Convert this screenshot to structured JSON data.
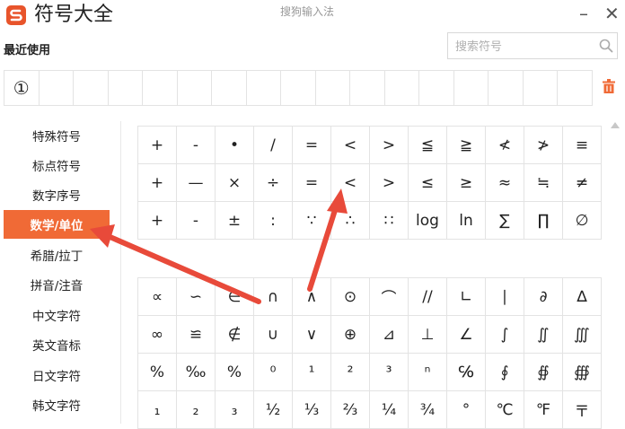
{
  "window": {
    "title": "符号大全",
    "subtitle": "搜狗输入法",
    "minimize_glyph": "–",
    "close_glyph": "✕"
  },
  "recent": {
    "label": "最近使用",
    "items": [
      "①",
      "",
      "",
      "",
      "",
      "",
      "",
      "",
      "",
      "",
      "",
      "",
      "",
      "",
      "",
      "",
      ""
    ]
  },
  "search": {
    "placeholder": "搜索符号",
    "value": ""
  },
  "sidebar": {
    "items": [
      {
        "label": "特殊符号",
        "active": false
      },
      {
        "label": "标点符号",
        "active": false
      },
      {
        "label": "数字序号",
        "active": false
      },
      {
        "label": "数学/单位",
        "active": true
      },
      {
        "label": "希腊/拉丁",
        "active": false
      },
      {
        "label": "拼音/注音",
        "active": false
      },
      {
        "label": "中文字符",
        "active": false
      },
      {
        "label": "英文音标",
        "active": false
      },
      {
        "label": "日文字符",
        "active": false
      },
      {
        "label": "韩文字符",
        "active": false
      }
    ]
  },
  "symbols_top": [
    [
      "+",
      "-",
      "•",
      "/",
      "=",
      "<",
      ">",
      "≦",
      "≧",
      "≮",
      "≯",
      "≡"
    ],
    [
      "+",
      "—",
      "×",
      "÷",
      "=",
      "<",
      ">",
      "≤",
      "≥",
      "≈",
      "≒",
      "≠"
    ],
    [
      "+",
      "-",
      "±",
      ":",
      "∵",
      "∴",
      "∷",
      "log",
      "ln",
      "∑",
      "∏",
      "∅"
    ]
  ],
  "symbols_bottom": [
    [
      "∝",
      "∽",
      "∈",
      "∩",
      "∧",
      "⊙",
      "⌒",
      "//",
      "∟",
      "∣",
      "∂",
      "∆"
    ],
    [
      "∞",
      "≌",
      "∉",
      "∪",
      "∨",
      "⊕",
      "⊿",
      "⊥",
      "∠",
      "∫",
      "∬",
      "∭"
    ],
    [
      "%",
      "‰",
      "%",
      "⁰",
      "¹",
      "²",
      "³",
      "ⁿ",
      "℅",
      "∮",
      "∯",
      "∰"
    ],
    [
      "₁",
      "₂",
      "₃",
      "½",
      "⅓",
      "⅔",
      "¼",
      "¾",
      "°",
      "℃",
      "℉",
      "〒"
    ]
  ],
  "colors": {
    "accent": "#f06a36",
    "logo": "#e8542b",
    "arrow": "#e84a3a"
  },
  "icons": {
    "logo": "sogou-s-logo",
    "search": "magnifier-icon",
    "trash": "trash-icon",
    "scroll_up": "triangle-up-icon"
  }
}
